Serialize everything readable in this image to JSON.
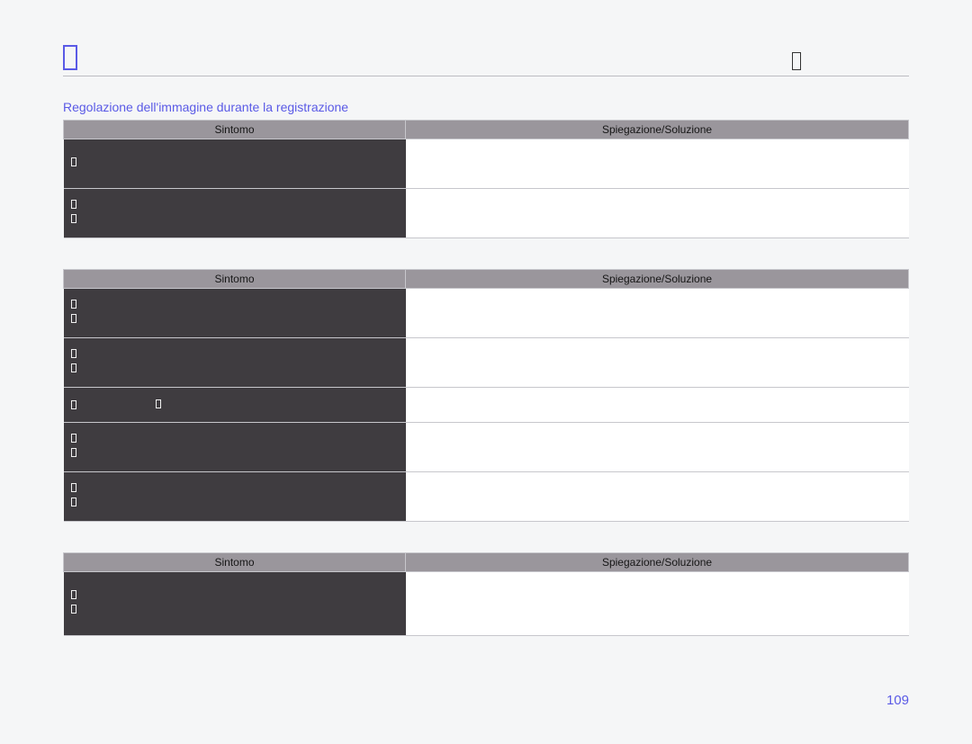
{
  "header": {
    "left_icon": "chapter-icon",
    "right_icon": "nav-icon"
  },
  "section_title": "Regolazione dell'immagine durante la registrazione",
  "col_labels": {
    "symptom": "Sintomo",
    "explanation": "Spiegazione/Soluzione"
  },
  "tables": [
    {
      "rows": [
        {
          "symptom_bullets": [
            ""
          ],
          "explanation": ""
        },
        {
          "symptom_bullets": [
            "",
            ""
          ],
          "explanation": ""
        }
      ]
    },
    {
      "rows": [
        {
          "symptom_bullets": [
            "",
            ""
          ],
          "explanation": ""
        },
        {
          "symptom_bullets": [
            "",
            ""
          ],
          "explanation": ""
        },
        {
          "symptom_bullets": [
            "",
            "→",
            ""
          ],
          "explanation": ""
        },
        {
          "symptom_bullets": [
            "",
            ""
          ],
          "explanation": ""
        },
        {
          "symptom_bullets": [
            "",
            ""
          ],
          "explanation": ""
        }
      ]
    },
    {
      "rows": [
        {
          "symptom_bullets": [
            "",
            ""
          ],
          "explanation": ""
        }
      ]
    }
  ],
  "page_number": "109"
}
